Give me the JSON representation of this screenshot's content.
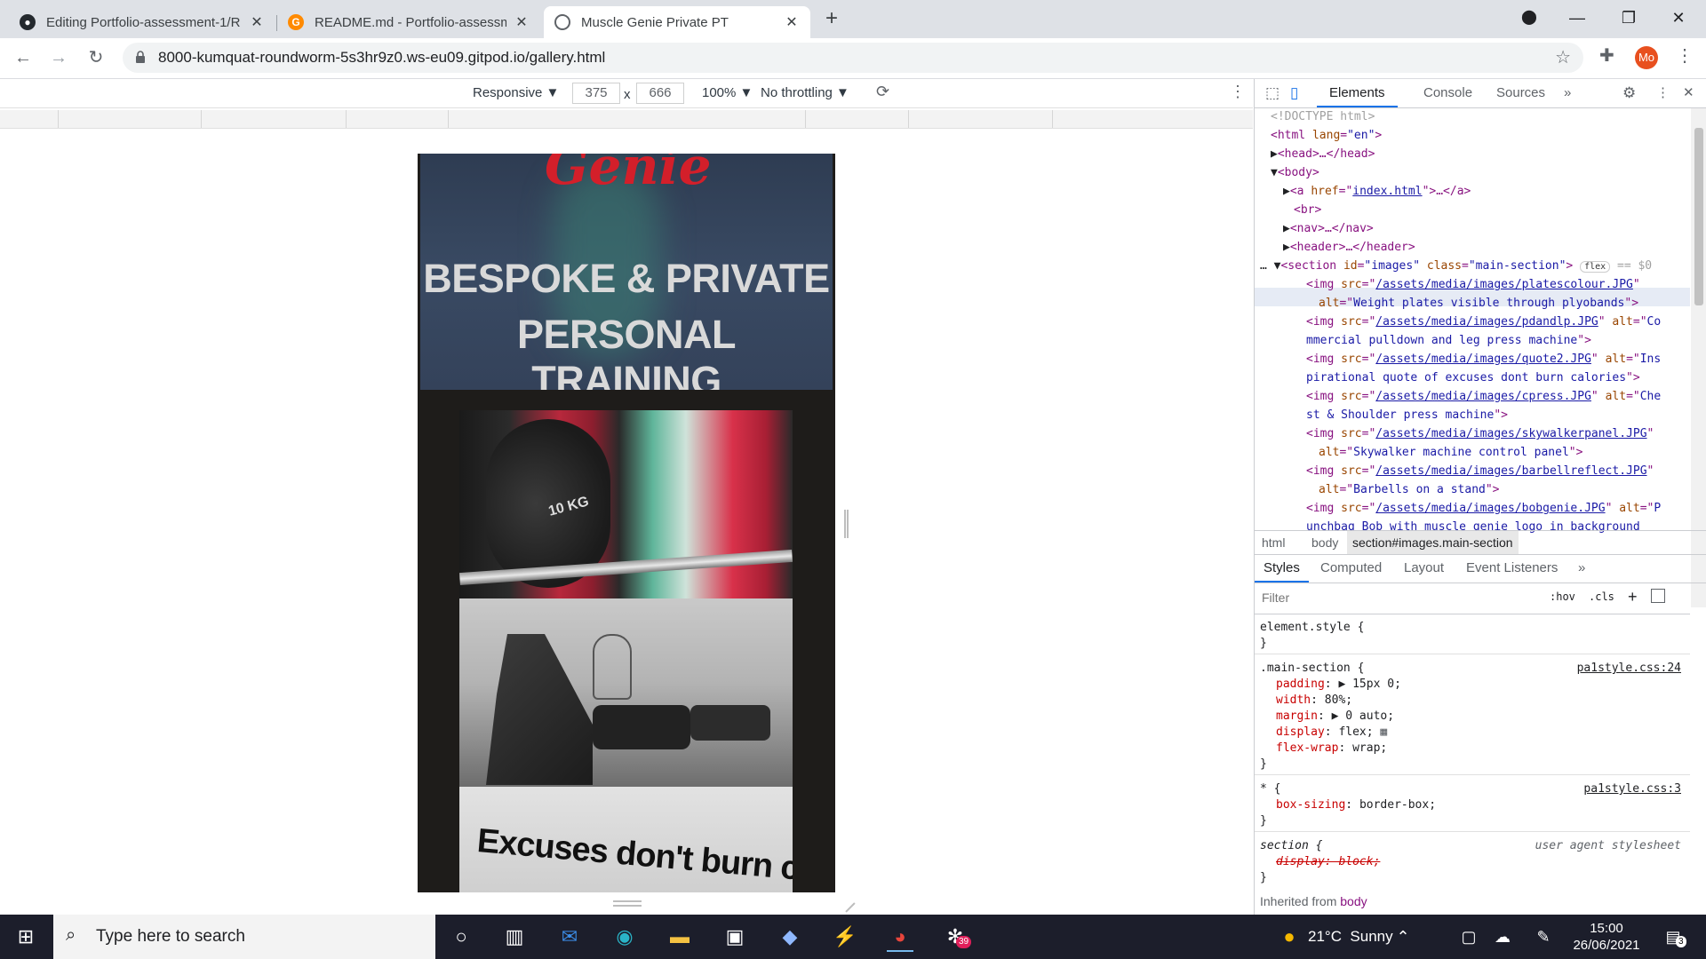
{
  "browser": {
    "tabs": [
      {
        "title": "Editing Portfolio-assessment-1/R",
        "icon": "github-icon"
      },
      {
        "title": "README.md - Portfolio-assessme",
        "icon": "gitpod-icon"
      },
      {
        "title": "Muscle Genie Private PT",
        "icon": "globe-icon"
      }
    ],
    "url": "8000-kumquat-roundworm-5s3hr9z0.ws-eu09.gitpod.io/gallery.html",
    "profile_initials": "Mo"
  },
  "device_toolbar": {
    "mode": "Responsive ▼",
    "width": "375",
    "times": "x",
    "height": "666",
    "zoom": "100% ▼",
    "throttling": "No throttling ▼"
  },
  "page": {
    "brand_script": "Genie",
    "hero_line1": "BESPOKE & PRIVATE",
    "hero_line2": "PERSONAL TRAINING",
    "image1_text": "10 KG",
    "quote_text": "Excuses don't burn calories"
  },
  "devtools": {
    "tabs": [
      "Elements",
      "Console",
      "Sources"
    ],
    "more": "»",
    "dom": {
      "l1": "<!DOCTYPE html>",
      "l2_tag": "<html ",
      "l2_attr": "lang",
      "l2_val": "\"en\"",
      "l2_end": ">",
      "l3": "<head>…</head>",
      "l4": "<body>",
      "l5_tag": "<a ",
      "l5_attr": "href",
      "l5_val": "index.html",
      "l5_end": ">…</a>",
      "l6": "<br>",
      "l7": "<nav>…</nav>",
      "l8": "<header>…</header>",
      "l9_tag": "<section ",
      "l9_a1": "id",
      "l9_v1": "\"images\"",
      "l9_a2": "class",
      "l9_v2": "\"main-section\"",
      "l9_end": ">",
      "l9_badge": "flex",
      "l9_eq": "== $0",
      "img_lines": [
        {
          "src": "/assets/media/images/platescolour.JPG",
          "alt": "Weight plates visible through plyobands"
        },
        {
          "src": "/assets/media/images/pdandlp.JPG",
          "alt_a": "Co",
          "alt_b": "mmercial pulldown and leg press machine"
        },
        {
          "src": "/assets/media/images/quote2.JPG",
          "alt_a": "Ins",
          "alt_b": "pirational quote of excuses dont burn calories"
        },
        {
          "src": "/assets/media/images/cpress.JPG",
          "alt_a": "Che",
          "alt_b": "st & Shoulder press machine"
        },
        {
          "src": "/assets/media/images/skywalkerpanel.JPG",
          "alt": "Skywalker machine control panel"
        },
        {
          "src": "/assets/media/images/barbellreflect.JPG",
          "alt": "Barbells on a stand"
        },
        {
          "src": "/assets/media/images/bobgenie.JPG",
          "alt_a": "P",
          "alt_b": "unchbag Bob with muscle genie logo in background"
        }
      ]
    },
    "breadcrumbs": [
      "html",
      "body",
      "section#images.main-section"
    ],
    "style_tabs": [
      "Styles",
      "Computed",
      "Layout",
      "Event Listeners"
    ],
    "filter_placeholder": "Filter",
    "filter_hov": ":hov",
    "filter_cls": ".cls",
    "styles": {
      "element_style": "element.style {",
      "close": "}",
      "rule1_selector": ".main-section {",
      "rule1_source": "pa1style.css:24",
      "rule1_props": [
        {
          "name": "padding",
          "value": "▶ 15px 0;"
        },
        {
          "name": "width",
          "value": "80%;"
        },
        {
          "name": "margin",
          "value": "▶ 0 auto;"
        },
        {
          "name": "display",
          "value": "flex;"
        },
        {
          "name": "flex-wrap",
          "value": "wrap;"
        }
      ],
      "rule2_selector": "* {",
      "rule2_source": "pa1style.css:3",
      "rule2_prop": "box-sizing",
      "rule2_value": "border-box;",
      "rule3_selector": "section {",
      "rule3_source": "user agent stylesheet",
      "rule3_prop": "display: block;",
      "inherited_label": "Inherited from",
      "inherited_from": "body"
    }
  },
  "taskbar": {
    "search_placeholder": "Type here to search",
    "weather": "21°C  Sunny",
    "time": "15:00",
    "date": "26/06/2021",
    "notifications": "3",
    "slack_badge": "39"
  },
  "colors": {
    "accent": "#1a73e8",
    "genie_red": "#d31f2a",
    "hero_bg": "#34425a"
  }
}
